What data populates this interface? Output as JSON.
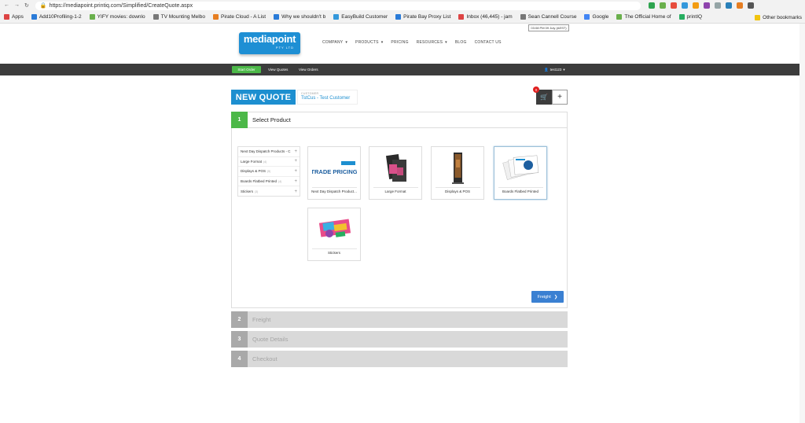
{
  "browser": {
    "url": "https://mediapoint.printiq.com/Simplified/CreateQuote.aspx",
    "bookmarks": [
      {
        "label": "Apps",
        "color": "#d44"
      },
      {
        "label": "Add10Profiling-1-2",
        "color": "#2a7bd8"
      },
      {
        "label": "YIFY movies: downlo",
        "color": "#6ab04c"
      },
      {
        "label": "TV Mounting Melbo",
        "color": "#777"
      },
      {
        "label": "Pirate Cloud - A List",
        "color": "#e67e22"
      },
      {
        "label": "Why we shouldn't b",
        "color": "#2a7bd8"
      },
      {
        "label": "EasyBuild Customer",
        "color": "#3498db"
      },
      {
        "label": "Pirate Bay Proxy List",
        "color": "#2a7bd8"
      },
      {
        "label": "Inbox (46,445) - jam",
        "color": "#d44"
      },
      {
        "label": "Sean Cannell Course",
        "color": "#777"
      },
      {
        "label": "Google",
        "color": "#4285f4"
      },
      {
        "label": "The Official Home of",
        "color": "#6ab04c"
      },
      {
        "label": "printIQ",
        "color": "#27ae60"
      }
    ],
    "other_bookmarks": "Other bookmarks",
    "tooltip": "03:08 PM 09 July (AEST)"
  },
  "site": {
    "logo_main": "mediapoint",
    "logo_sub": "PTY LTD",
    "nav": [
      {
        "label": "COMPANY",
        "caret": "▾"
      },
      {
        "label": "PRODUCTS",
        "caret": "▾"
      },
      {
        "label": "PRICING",
        "caret": ""
      },
      {
        "label": "RESOURCES",
        "caret": "▾"
      },
      {
        "label": "BLOG",
        "caret": ""
      },
      {
        "label": "CONTACT US",
        "caret": ""
      }
    ],
    "subnav": {
      "start": "Start Order",
      "quotes": "View Quotes",
      "orders": "View Orders"
    },
    "user": "test123"
  },
  "quote": {
    "title": "NEW QUOTE",
    "customer_label": "CUSTOMER",
    "customer_name": "TstCus - Test Customer",
    "cart_count": "0",
    "plus": "+"
  },
  "steps": [
    {
      "num": "1",
      "title": "Select Product"
    },
    {
      "num": "2",
      "title": "Freight"
    },
    {
      "num": "3",
      "title": "Quote Details"
    },
    {
      "num": "4",
      "title": "Checkout"
    }
  ],
  "categories": [
    {
      "label": "Next Day Dispatch Products - C",
      "count": ""
    },
    {
      "label": "Large Format",
      "count": "(4)"
    },
    {
      "label": "Displays & POS",
      "count": "(5)"
    },
    {
      "label": "Boards Flatbed Printed",
      "count": "(4)"
    },
    {
      "label": "Stickers",
      "count": "(3)"
    }
  ],
  "products": [
    {
      "label": "Next Day Dispatch Product...",
      "thumb_text": "TRADE PRICING"
    },
    {
      "label": "Large Format"
    },
    {
      "label": "Displays & POS"
    },
    {
      "label": "Boards Flatbed Printed"
    },
    {
      "label": "Stickers"
    }
  ],
  "freight_button": "Freight"
}
